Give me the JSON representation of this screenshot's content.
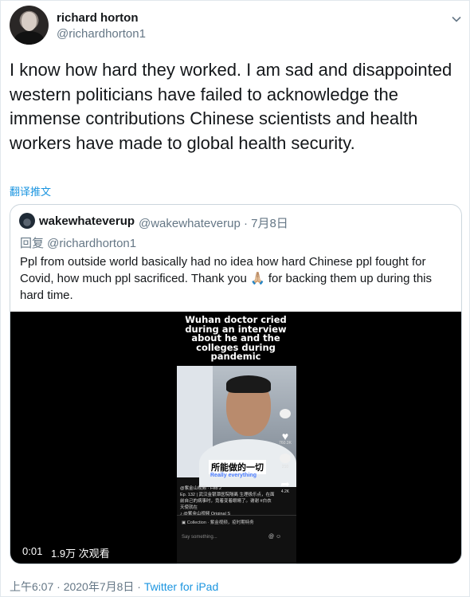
{
  "author": {
    "name": "richard horton",
    "handle": "@richardhorton1"
  },
  "tweet": {
    "text": "I know how hard they worked. I am sad and disappointed western politicians have failed to acknowledge the immense contributions Chinese scientists and health workers have made to global health security.",
    "translate": "翻译推文"
  },
  "quote": {
    "name": "wakewhateverup",
    "handle": "@wakewhateverup · 7月8日",
    "reply_to": "回复 @richardhorton1",
    "text": "Ppl from outside world basically had no idea how hard Chinese ppl fought for Covid, how much ppl sacrificed. Thank you 🙏🏼 for backing them up during this hard time."
  },
  "video": {
    "overlay_title": "Wuhan doctor cried during an interview about he and the colleges during pandemic",
    "subtitle_cn": "所能做的一切",
    "subtitle_en": "Really everything",
    "elapsed": "0:01",
    "views": "1.9万 次观看",
    "phone": {
      "meta_line1": "@紫金山视频 · Feb 2",
      "meta_line2": "Ep. 132 | 武汉金银潭医院隔离 生理极乐点，在面前自己的病事时，竟着变着眼睛了。谢谢 #白衣天使就在",
      "meta_line3": "♪ @紫金山视频 Original S",
      "collection": "▣ Collection · 紫金视频，疫时期特务",
      "comment_placeholder": "Say something...",
      "like_count": "760.3K",
      "comment_count": "210",
      "share_count": "4.2K"
    }
  },
  "footer": {
    "time": "上午6:07 · 2020年7月8日 · ",
    "source": "Twitter for iPad"
  },
  "colors": {
    "link": "#1b95e0",
    "secondary_text": "#657786",
    "border": "#ccd6dd"
  }
}
